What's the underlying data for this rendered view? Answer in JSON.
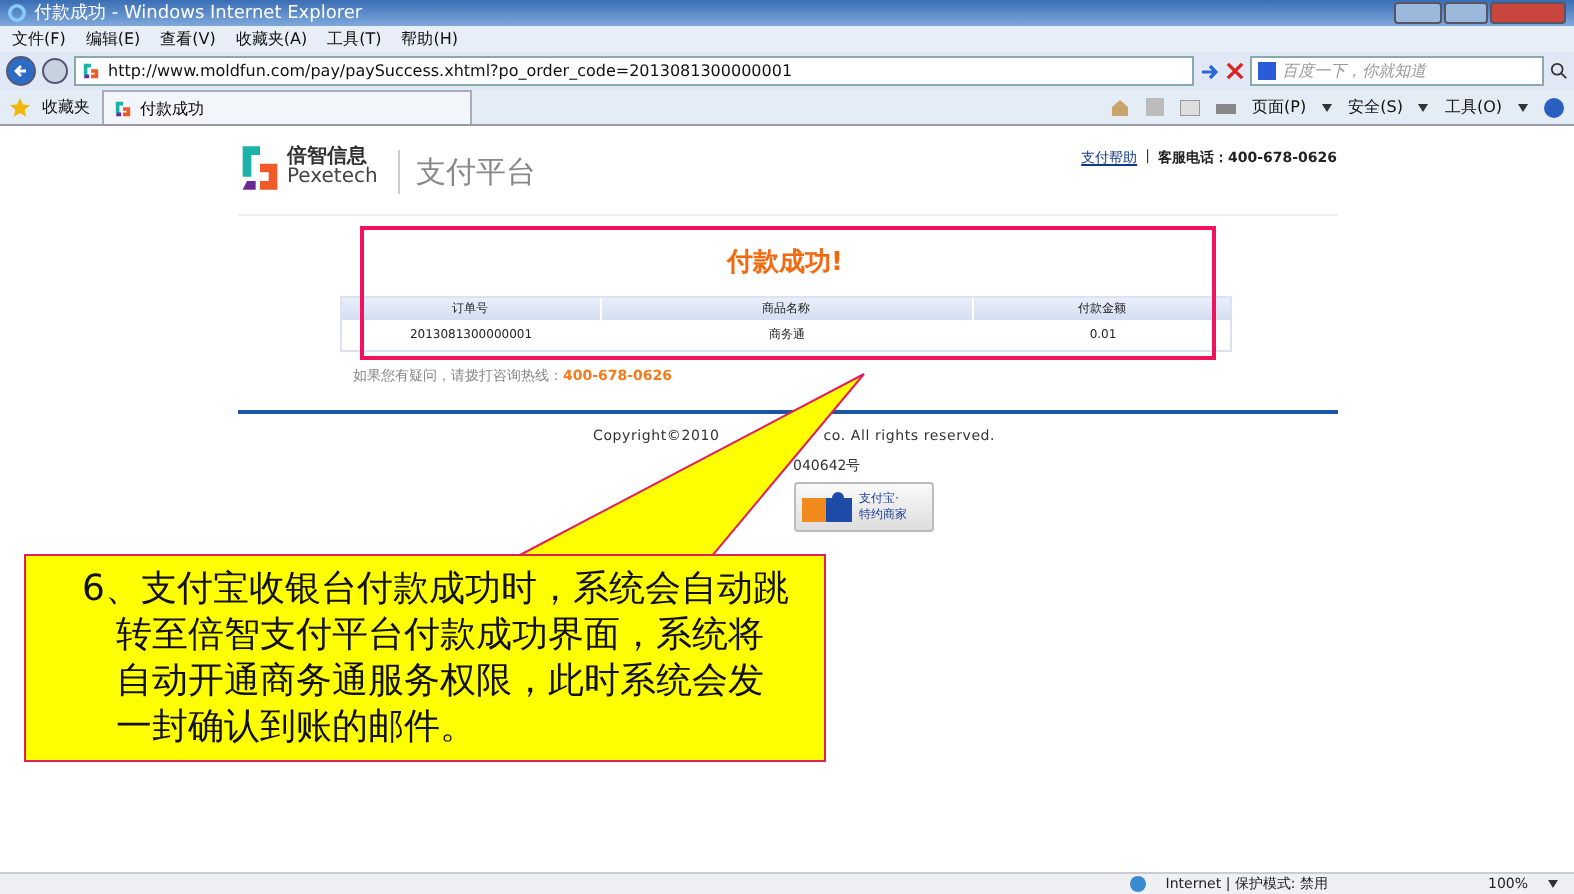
{
  "window": {
    "title": "付款成功 - Windows Internet Explorer"
  },
  "menu": [
    "文件(F)",
    "编辑(E)",
    "查看(V)",
    "收藏夹(A)",
    "工具(T)",
    "帮助(H)"
  ],
  "address_bar": {
    "url": "http://www.moldfun.com/pay/paySuccess.xhtml?po_order_code=2013081300000001",
    "search_placeholder": "百度一下，你就知道"
  },
  "favorites_bar": {
    "favorites": "收藏夹",
    "tab": "付款成功",
    "commands": [
      "页面(P)",
      "安全(S)",
      "工具(O)"
    ]
  },
  "page": {
    "logo_cn": "倍智信息",
    "logo_en": "Pexetech",
    "platform": "支付平台",
    "help_link": "支付帮助",
    "separator": "|",
    "hotline": "客服电话：400-678-0626",
    "success_title": "付款成功!",
    "table": {
      "columns": [
        "订单号",
        "商品名称",
        "付款金额"
      ],
      "rows": [
        [
          "2013081300000001",
          "商务通",
          "0.01"
        ]
      ]
    },
    "question": "如果您有疑问，请拨打咨询热线：",
    "question_phone": "400-678-0626",
    "copyright_left": "Copyright©2010",
    "copyright_right": "co. All rights reserved.",
    "icp": "040642号",
    "badge_lines": [
      "支付宝·",
      "特约商家"
    ]
  },
  "callout": {
    "lines": [
      "6、支付宝收银台付款成功时，系统会自动跳",
      "转至倍智支付平台付款成功界面，系统将",
      "自动开通商务通服务权限，此时系统会发",
      "一封确认到账的邮件。"
    ]
  },
  "status_bar": {
    "zone": "Internet | 保护模式: 禁用",
    "zoom": "100%"
  }
}
